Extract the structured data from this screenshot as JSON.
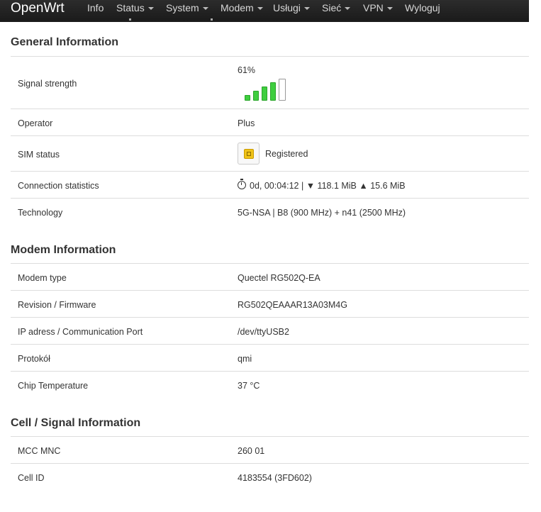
{
  "nav": {
    "brand": "OpenWrt",
    "items": [
      {
        "label": "Info",
        "caret": false
      },
      {
        "label": "Status",
        "caret": true
      },
      {
        "label": "System",
        "caret": true
      },
      {
        "label": "Modem",
        "caret": true
      },
      {
        "label": "Usługi",
        "caret": true
      },
      {
        "label": "Sieć",
        "caret": true
      },
      {
        "label": "VPN",
        "caret": true
      },
      {
        "label": "Wyloguj",
        "caret": false
      }
    ]
  },
  "general": {
    "title": "General Information",
    "signal_label": "Signal strength",
    "signal_percent": "61%",
    "signal_bars": {
      "filled": 4,
      "total": 5,
      "color": "#3fce3f"
    },
    "operator_label": "Operator",
    "operator_value": "Plus",
    "sim_label": "SIM status",
    "sim_value": "Registered",
    "conn_label": "Connection statistics",
    "conn_value": "0d, 00:04:12 | ▼ 118.1 MiB ▲ 15.6 MiB",
    "tech_label": "Technology",
    "tech_value": "5G-NSA | B8 (900 MHz) + n41 (2500 MHz)"
  },
  "modem": {
    "title": "Modem Information",
    "type_label": "Modem type",
    "type_value": "Quectel RG502Q-EA",
    "firmware_label": "Revision / Firmware",
    "firmware_value": "RG502QEAAAR13A03M4G",
    "port_label": "IP adress / Communication Port",
    "port_value": "/dev/ttyUSB2",
    "protocol_label": "Protokół",
    "protocol_value": "qmi",
    "temp_label": "Chip Temperature",
    "temp_value": "37 °C"
  },
  "cell": {
    "title": "Cell / Signal Information",
    "mccmnc_label": "MCC MNC",
    "mccmnc_value": "260 01",
    "cellid_label": "Cell ID",
    "cellid_value": "4183554 (3FD602)"
  }
}
